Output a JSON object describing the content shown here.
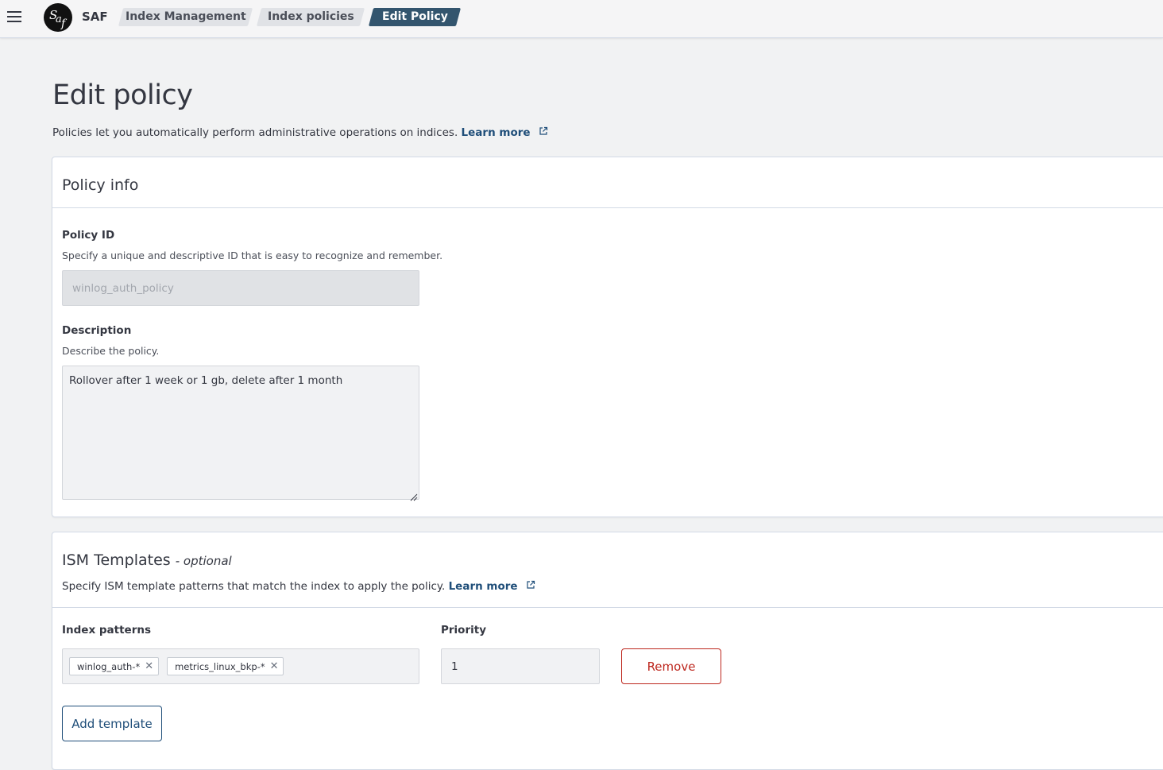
{
  "header": {
    "app_name": "SAF",
    "logo_text": "Saf",
    "breadcrumbs": [
      "Index Management",
      "Index policies",
      "Edit Policy"
    ]
  },
  "page": {
    "title": "Edit policy",
    "description": "Policies let you automatically perform administrative operations on indices.",
    "learn_more": "Learn more"
  },
  "policy_info": {
    "title": "Policy info",
    "policy_id_label": "Policy ID",
    "policy_id_help": "Specify a unique and descriptive ID that is easy to recognize and remember.",
    "policy_id_value": "winlog_auth_policy",
    "description_label": "Description",
    "description_help": "Describe the policy.",
    "description_value": "Rollover after 1 week or 1 gb, delete after 1 month"
  },
  "ism_templates": {
    "title": "ISM Templates",
    "optional": "- optional",
    "help": "Specify ISM template patterns that match the index to apply the policy.",
    "learn_more": "Learn more",
    "index_patterns_label": "Index patterns",
    "index_patterns": [
      "winlog_auth-*",
      "metrics_linux_bkp-*"
    ],
    "priority_label": "Priority",
    "priority_value": "1",
    "remove_label": "Remove",
    "add_template_label": "Add template"
  },
  "colors": {
    "accent": "#33556e",
    "link": "#1f4e79",
    "danger": "#bd271e"
  }
}
